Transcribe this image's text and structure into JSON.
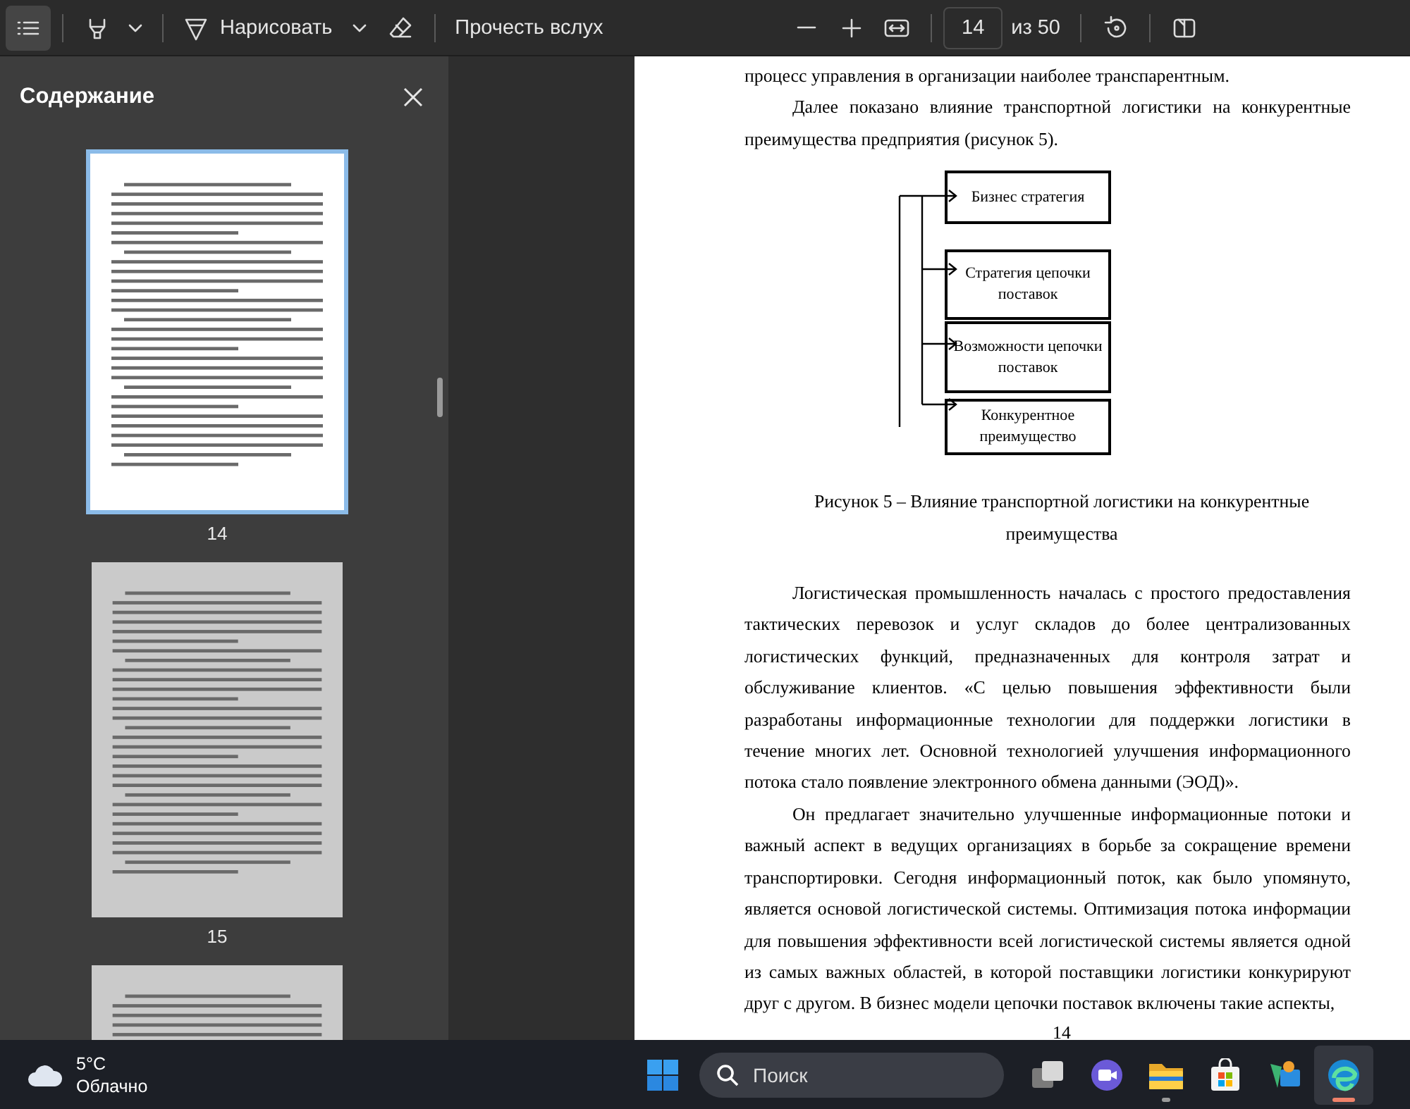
{
  "toolbar": {
    "contents_button": {
      "selected": true
    },
    "draw_label": "Нарисовать",
    "read_aloud": "Прочесть вслух",
    "page_field": {
      "value": "14"
    },
    "page_total": "из 50"
  },
  "sidebar": {
    "title": "Содержание",
    "thumbnails": [
      {
        "page_label": "14",
        "selected": true
      },
      {
        "page_label": "15",
        "selected": false
      },
      {
        "selected": false
      }
    ]
  },
  "page": {
    "blocks": [
      {
        "kind": "text",
        "indent": false,
        "text": "процесс управления в организации наиболее транспарентным."
      },
      {
        "kind": "text",
        "indent": true,
        "text": "Далее показано влияние транспортной логистики на конкурентные преимущества предприятия (рисунок 5)."
      },
      {
        "kind": "diagram",
        "nodes": [
          "Бизнес стратегия",
          "Стратегия цепочки поставок",
          "Возможности цепочки поставок",
          "Конкурентное преимущество"
        ]
      },
      {
        "kind": "caption",
        "text": "Рисунок 5 – Влияние транспортной логистики на конкурентные преимущества"
      },
      {
        "kind": "text",
        "indent": true,
        "text": "Логистическая промышленность началась с простого предоставления тактических перевозок и услуг складов до более централизованных логистических функций, предназначенных для контроля затрат и обслуживание клиентов. «С целью повышения эффективности были разработаны информационные технологии для поддержки логистики в течение многих лет. Основной технологией улучшения информационного потока стало появление электронного обмена данными (ЭОД)»."
      },
      {
        "kind": "text",
        "indent": true,
        "text": "Он предлагает значительно улучшенные информационные потоки и важный аспект в ведущих организациях в борьбе за сокращение времени транспортировки. Сегодня информационный поток, как было упомянуто, является основой логистической системы. Оптимизация потока информации для повышения эффективности всей логистической системы является одной из самых важных областей, в которой поставщики логистики конкурируют друг с другом. В бизнес модели цепочки поставок включены такие аспекты,"
      }
    ],
    "page_number": "14"
  },
  "taskbar": {
    "weather": {
      "temperature": "5°C",
      "condition": "Облачно"
    },
    "search": {
      "placeholder": "Поиск"
    },
    "apps": [
      {
        "kind": "task-view",
        "open": false,
        "selected": false
      },
      {
        "kind": "chat",
        "open": false,
        "selected": false
      },
      {
        "kind": "folder",
        "open": true,
        "selected": false
      },
      {
        "kind": "store",
        "open": false,
        "selected": false
      },
      {
        "kind": "photos",
        "open": false,
        "selected": false
      },
      {
        "kind": "browser",
        "open": true,
        "selected": true
      }
    ]
  }
}
